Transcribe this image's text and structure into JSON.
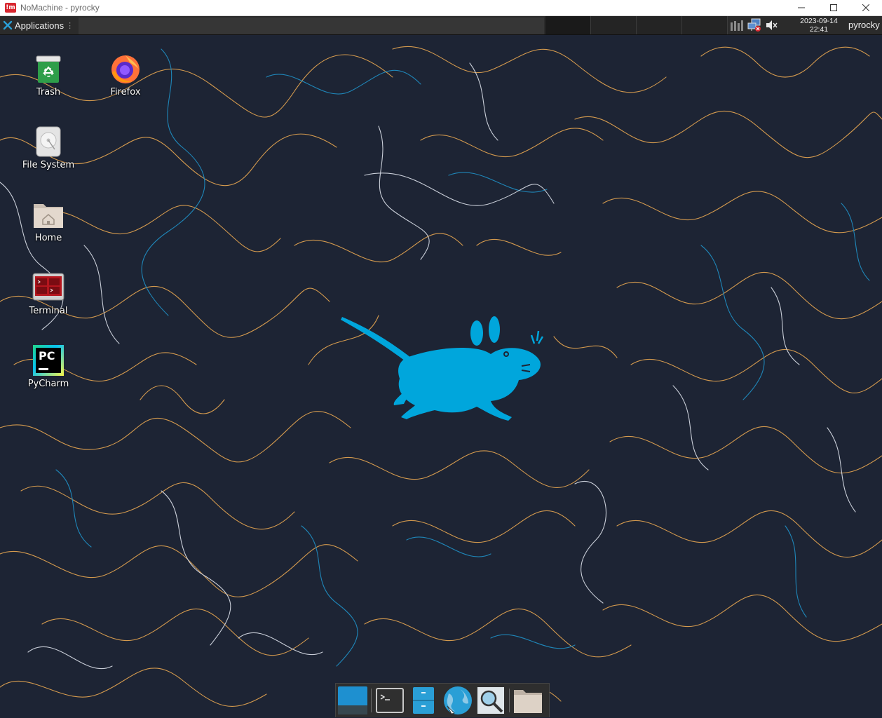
{
  "window": {
    "title": "NoMachine - pyrocky",
    "logo_text": "!m",
    "controls": [
      "minimize-icon",
      "maximize-icon",
      "close-icon"
    ]
  },
  "panel": {
    "applications_label": "Applications",
    "grip_glyph": "⋮",
    "workspace_count": 4,
    "active_workspace": 1,
    "tray_icons": [
      "panel-grid-icon",
      "network-disconnected-icon",
      "volume-muted-icon"
    ],
    "clock": {
      "date": "2023-09-14",
      "time": "22:41"
    },
    "user": "pyrocky"
  },
  "desktop": {
    "icons": [
      {
        "name": "trash",
        "label": "Trash",
        "icon": "trash-icon"
      },
      {
        "name": "firefox",
        "label": "Firefox",
        "icon": "firefox-icon"
      },
      {
        "name": "filesystem",
        "label": "File System",
        "icon": "drive-icon"
      },
      {
        "name": "home",
        "label": "Home",
        "icon": "home-folder-icon"
      },
      {
        "name": "terminal",
        "label": "Terminal",
        "icon": "terminal-icon"
      },
      {
        "name": "pycharm",
        "label": "PyCharm",
        "icon": "pycharm-icon"
      }
    ],
    "pycharm_text": "PC",
    "wallpaper": "xfce-mouse-topographic",
    "accent": "#00a6dc"
  },
  "dock": {
    "items": [
      "show-desktop-icon",
      "terminal-icon",
      "file-manager-icon",
      "web-browser-icon",
      "app-finder-icon",
      "folder-icon"
    ]
  },
  "colors": {
    "background": "#1d2434",
    "contour_orange": "#d49a4e",
    "contour_blue": "#1f86b8",
    "contour_white": "#c9ced8",
    "mouse_blue": "#00a6dc",
    "panel": "#2b2b2b"
  }
}
